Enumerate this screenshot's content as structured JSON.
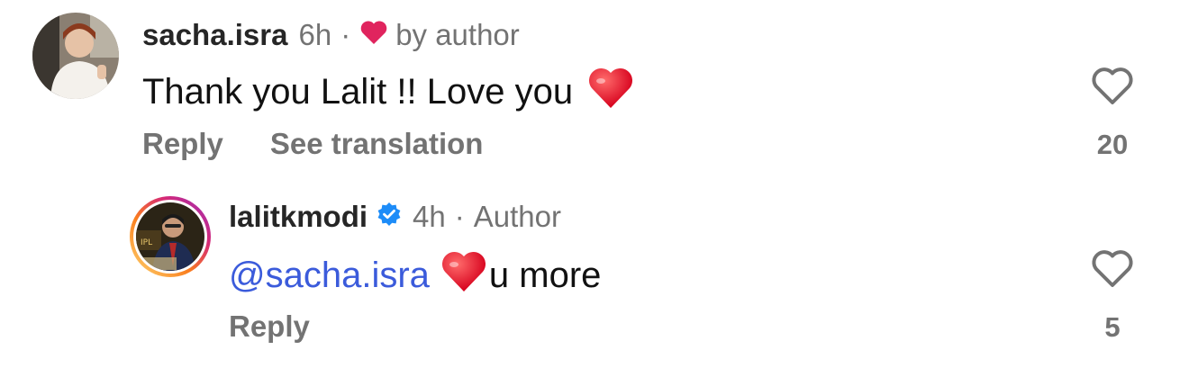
{
  "comments": [
    {
      "username": "sacha.isra",
      "time": "6h",
      "liked_label": "by author",
      "text": "Thank you Lalit !! Love you",
      "emoji": "red-heart",
      "actions": [
        "Reply",
        "See translation"
      ],
      "like_count": "20"
    },
    {
      "username": "lalitkmodi",
      "verified": true,
      "time": "4h",
      "author_label": "Author",
      "mention": "@sacha.isra",
      "emoji": "red-heart",
      "text": "u more",
      "actions": [
        "Reply"
      ],
      "like_count": "5"
    }
  ],
  "colors": {
    "username": "#262626",
    "meta": "#737373",
    "mention": "#3b5bdb",
    "heart": "#e0245e",
    "verified": "#1d8cf8"
  }
}
